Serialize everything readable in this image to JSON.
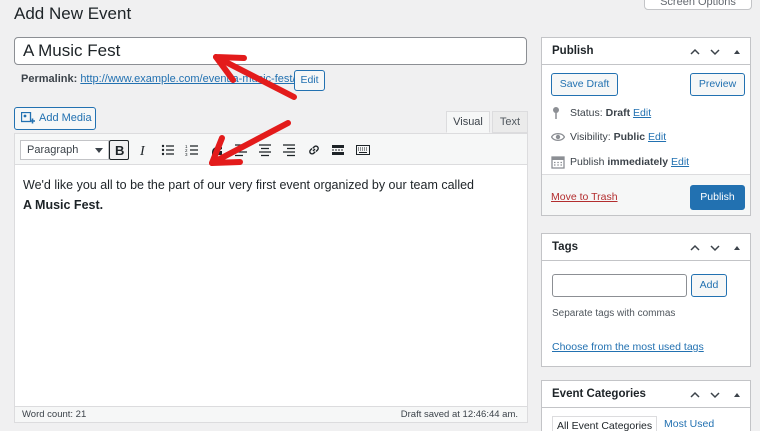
{
  "page": {
    "title": "Add New Event",
    "screen_options": "Screen Options"
  },
  "post": {
    "title": "A Music Fest",
    "permalink_label": "Permalink:",
    "permalink_url": "http://www.example.com/event/a-music-fest/",
    "edit_label": "Edit"
  },
  "editor": {
    "add_media_label": "Add Media",
    "tabs": {
      "visual": "Visual",
      "text": "Text"
    },
    "format_select": "Paragraph",
    "toolbar_icons": [
      "bold-icon",
      "italic-icon",
      "bullet-list-icon",
      "numbered-list-icon",
      "blockquote-icon",
      "align-left-icon",
      "align-center-icon",
      "align-right-icon",
      "link-icon",
      "read-more-icon",
      "toolbar-toggle-icon"
    ],
    "content_text": "We'd like you all to be the part of our very first event organized by our team called",
    "content_bold": "A Music Fest.",
    "word_count": "Word count: 21",
    "draft_saved": "Draft saved at 12:46:44 am."
  },
  "publish_box": {
    "title": "Publish",
    "save_draft": "Save Draft",
    "preview": "Preview",
    "status_label": "Status:",
    "status_value": "Draft",
    "visibility_label": "Visibility:",
    "visibility_value": "Public",
    "publish_label": "Publish",
    "publish_value": "immediately",
    "edit_link": "Edit",
    "move_to_trash": "Move to Trash",
    "publish_button": "Publish"
  },
  "tags_box": {
    "title": "Tags",
    "add_button": "Add",
    "hint": "Separate tags with commas",
    "choose_link": "Choose from the most used tags"
  },
  "categories_box": {
    "title": "Event Categories",
    "tabs": [
      "All Event Categories",
      "Most Used"
    ]
  },
  "colors": {
    "accent": "#2271b1",
    "annotation_arrow": "#e31b1b",
    "trash": "#b32d2e"
  }
}
